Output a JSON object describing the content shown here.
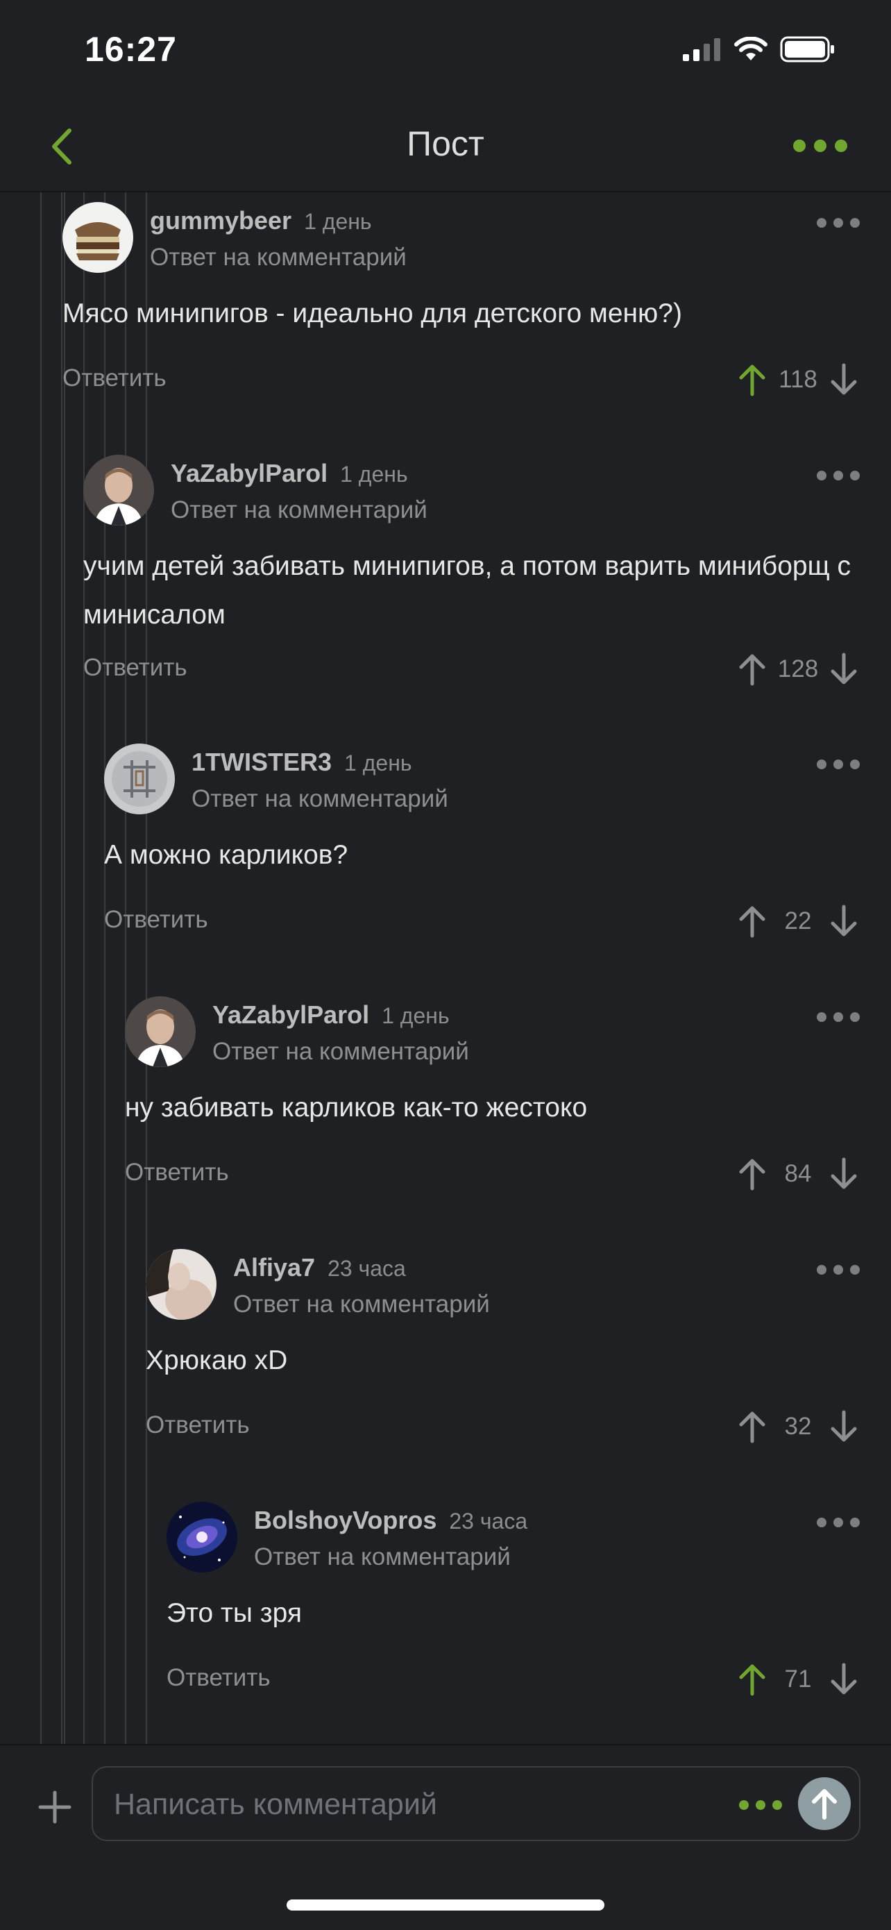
{
  "status_bar": {
    "time": "16:27"
  },
  "header": {
    "title": "Пост"
  },
  "colors": {
    "accent": "#71a72f",
    "background": "#1e2023",
    "muted": "#8d8f93"
  },
  "comments": [
    {
      "user": "gummybeer",
      "time": "1 день",
      "reply_label": "Ответ на комментарий",
      "text": "Мясо минипигов - идеально для детского меню?)",
      "reply_btn": "Ответить",
      "rating": "118",
      "upvoted": true,
      "avatar": "sandwich-avatar"
    },
    {
      "user": "YaZabylParol",
      "time": "1 день",
      "reply_label": "Ответ на комментарий",
      "text": "учим детей забивать минипигов, а потом варить миниборщ с минисалом",
      "reply_btn": "Ответить",
      "rating": "128",
      "upvoted": false,
      "avatar": "man-portrait-avatar"
    },
    {
      "user": "1TWISTER3",
      "time": "1 день",
      "reply_label": "Ответ на комментарий",
      "text": "А можно карликов?",
      "reply_btn": "Ответить",
      "rating": "22",
      "upvoted": false,
      "avatar": "logo-avatar"
    },
    {
      "user": "YaZabylParol",
      "time": "1 день",
      "reply_label": "Ответ на комментарий",
      "text": "ну забивать карликов как-то жестоко",
      "reply_btn": "Ответить",
      "rating": "84",
      "upvoted": false,
      "avatar": "man-portrait-avatar"
    },
    {
      "user": "Alfiya7",
      "time": "23 часа",
      "reply_label": "Ответ на комментарий",
      "text": "Хрюкаю xD",
      "reply_btn": "Ответить",
      "rating": "32",
      "upvoted": false,
      "avatar": "portrait-avatar"
    },
    {
      "user": "BolshoyVopros",
      "time": "23 часа",
      "reply_label": "Ответ на комментарий",
      "text": "Это ты зря",
      "reply_btn": "Ответить",
      "rating": "71",
      "upvoted": true,
      "avatar": "galaxy-avatar"
    }
  ],
  "composer": {
    "placeholder": "Написать комментарий"
  }
}
